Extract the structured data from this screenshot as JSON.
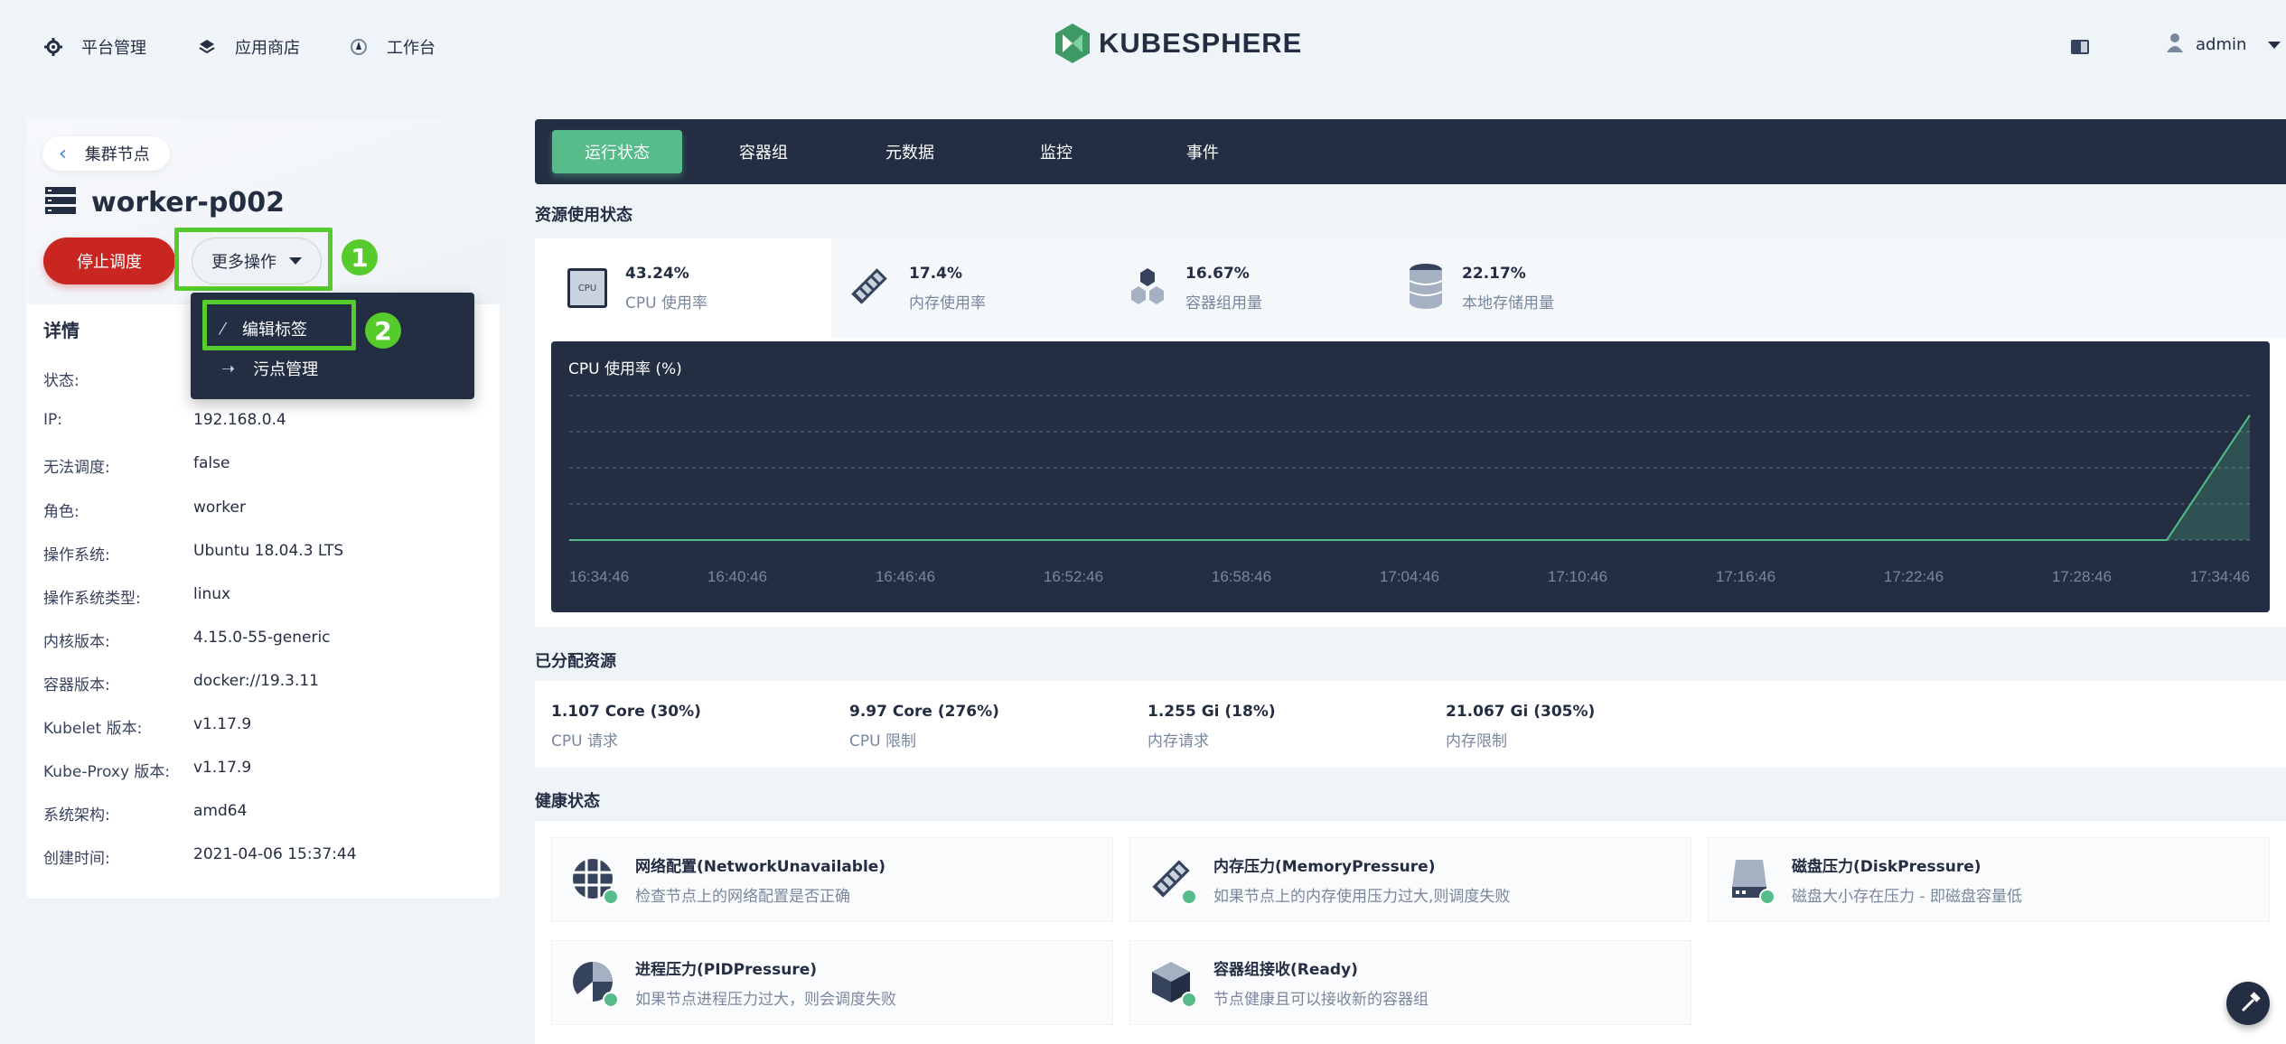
{
  "header": {
    "nav": [
      {
        "label": "平台管理",
        "icon": "gear-icon"
      },
      {
        "label": "应用商店",
        "icon": "layers-icon"
      },
      {
        "label": "工作台",
        "icon": "compass-icon"
      }
    ],
    "logo_text": "KUBESPHERE",
    "user": "admin"
  },
  "node": {
    "back_label": "集群节点",
    "name": "worker-p002",
    "stop_button": "停止调度",
    "more_button": "更多操作",
    "menu": [
      "编辑标签",
      "污点管理"
    ],
    "callouts": [
      "1",
      "2"
    ],
    "details_title": "详情",
    "details": [
      {
        "k": "状态:",
        "v": ""
      },
      {
        "k": "IP:",
        "v": "192.168.0.4"
      },
      {
        "k": "无法调度:",
        "v": "false"
      },
      {
        "k": "角色:",
        "v": "worker"
      },
      {
        "k": "操作系统:",
        "v": "Ubuntu 18.04.3 LTS"
      },
      {
        "k": "操作系统类型:",
        "v": "linux"
      },
      {
        "k": "内核版本:",
        "v": "4.15.0-55-generic"
      },
      {
        "k": "容器版本:",
        "v": "docker://19.3.11"
      },
      {
        "k": "Kubelet 版本:",
        "v": "v1.17.9"
      },
      {
        "k": "Kube-Proxy 版本:",
        "v": "v1.17.9"
      },
      {
        "k": "系统架构:",
        "v": "amd64"
      },
      {
        "k": "创建时间:",
        "v": "2021-04-06 15:37:44"
      }
    ]
  },
  "tabs": [
    "运行状态",
    "容器组",
    "元数据",
    "监控",
    "事件"
  ],
  "resource": {
    "title": "资源使用状态",
    "metrics": [
      {
        "value": "43.24%",
        "label": "CPU 使用率",
        "icon": "cpu-icon",
        "icon_text": "CPU"
      },
      {
        "value": "17.4%",
        "label": "内存使用率",
        "icon": "memory-icon"
      },
      {
        "value": "16.67%",
        "label": "容器组用量",
        "icon": "pods-icon"
      },
      {
        "value": "22.17%",
        "label": "本地存储用量",
        "icon": "storage-icon"
      }
    ]
  },
  "chart_data": {
    "type": "area",
    "title": "CPU 使用率 (%)",
    "x": [
      "16:34:46",
      "16:40:46",
      "16:46:46",
      "16:52:46",
      "16:58:46",
      "17:04:46",
      "17:10:46",
      "17:16:46",
      "17:22:46",
      "17:28:46",
      "17:34:46"
    ],
    "values": [
      0,
      0,
      0,
      0,
      0,
      0,
      0,
      0,
      0,
      0,
      43.24
    ],
    "grid": true,
    "line_color": "#55bc8a"
  },
  "allocated": {
    "title": "已分配资源",
    "items": [
      {
        "value": "1.107 Core (30%)",
        "label": "CPU 请求"
      },
      {
        "value": "9.97 Core (276%)",
        "label": "CPU 限制"
      },
      {
        "value": "1.255 Gi (18%)",
        "label": "内存请求"
      },
      {
        "value": "21.067 Gi (305%)",
        "label": "内存限制"
      }
    ]
  },
  "health": {
    "title": "健康状态",
    "items": [
      {
        "title": "网络配置(NetworkUnavailable)",
        "desc": "检查节点上的网络配置是否正确",
        "icon": "network-icon"
      },
      {
        "title": "内存压力(MemoryPressure)",
        "desc": "如果节点上的内存使用压力过大,则调度失败",
        "icon": "memory-icon"
      },
      {
        "title": "磁盘压力(DiskPressure)",
        "desc": "磁盘大小存在压力 - 即磁盘容量低",
        "icon": "disk-icon"
      },
      {
        "title": "进程压力(PIDPressure)",
        "desc": "如果节点进程压力过大，则会调度失败",
        "icon": "process-icon"
      },
      {
        "title": "容器组接收(Ready)",
        "desc": "节点健康且可以接收新的容器组",
        "icon": "box-icon"
      }
    ]
  },
  "colors": {
    "accent": "#55bc8a",
    "danger": "#ca2621",
    "dark": "#242e42",
    "highlight": "#55cc2b"
  }
}
